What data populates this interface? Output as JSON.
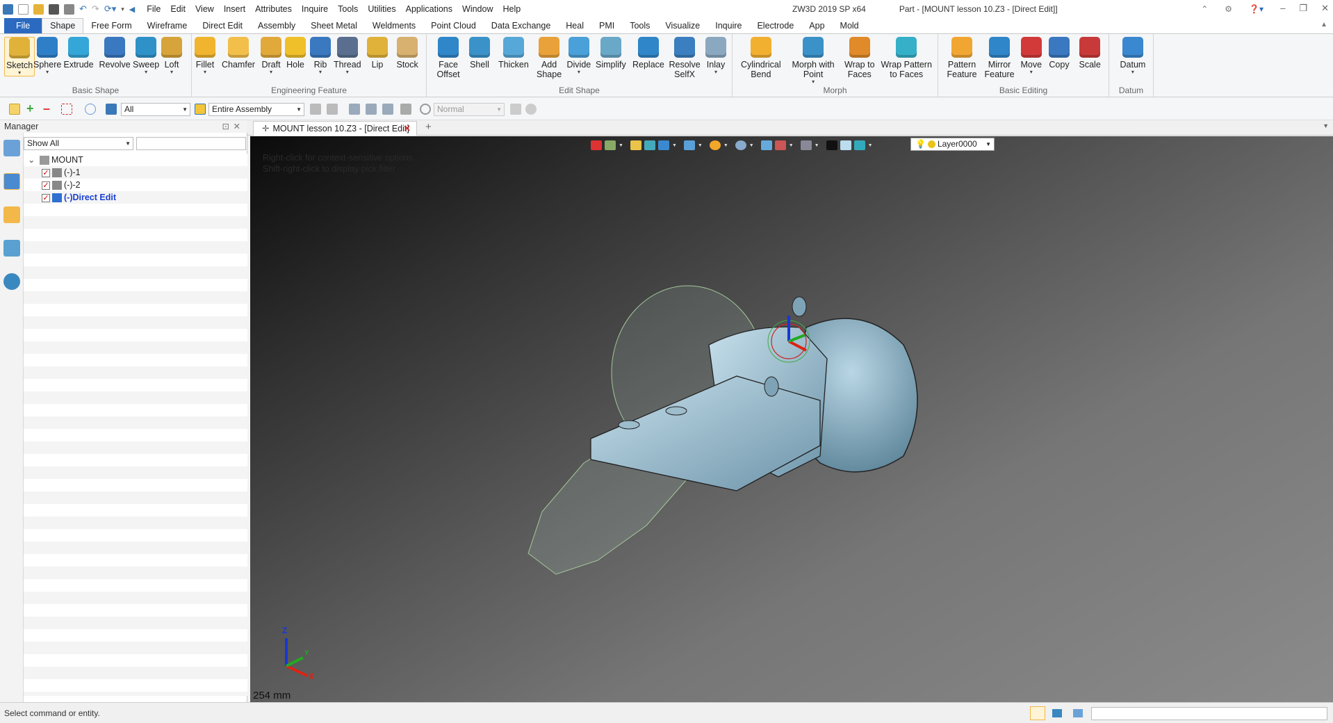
{
  "app": {
    "product": "ZW3D 2019 SP x64",
    "document_title": "Part - [MOUNT lesson 10.Z3 - [Direct Edit]]"
  },
  "menu": [
    "File",
    "Edit",
    "View",
    "Insert",
    "Attributes",
    "Inquire",
    "Tools",
    "Utilities",
    "Applications",
    "Window",
    "Help"
  ],
  "ribbon_tabs": [
    "File",
    "Shape",
    "Free Form",
    "Wireframe",
    "Direct Edit",
    "Assembly",
    "Sheet Metal",
    "Weldments",
    "Point Cloud",
    "Data Exchange",
    "Heal",
    "PMI",
    "Tools",
    "Visualize",
    "Inquire",
    "Electrode",
    "App",
    "Mold"
  ],
  "active_tab": "Shape",
  "ribbon_groups": [
    {
      "title": "Basic Shape",
      "buttons": [
        {
          "label": "Sketch",
          "icon": "sketch-icon"
        },
        {
          "label": "Sphere",
          "icon": "sphere-icon"
        },
        {
          "label": "Extrude",
          "icon": "extrude-icon"
        },
        {
          "label": "Revolve",
          "icon": "revolve-icon"
        },
        {
          "label": "Sweep",
          "icon": "sweep-icon"
        },
        {
          "label": "Loft",
          "icon": "loft-icon"
        }
      ]
    },
    {
      "title": "Engineering Feature",
      "buttons": [
        {
          "label": "Fillet",
          "icon": "fillet-icon"
        },
        {
          "label": "Chamfer",
          "icon": "chamfer-icon"
        },
        {
          "label": "Draft",
          "icon": "draft-icon"
        },
        {
          "label": "Hole",
          "icon": "hole-icon"
        },
        {
          "label": "Rib",
          "icon": "rib-icon"
        },
        {
          "label": "Thread",
          "icon": "thread-icon"
        },
        {
          "label": "Lip",
          "icon": "lip-icon"
        },
        {
          "label": "Stock",
          "icon": "stock-icon"
        }
      ]
    },
    {
      "title": "Edit Shape",
      "buttons": [
        {
          "label": "Face\nOffset",
          "icon": "face-offset-icon"
        },
        {
          "label": "Shell",
          "icon": "shell-icon"
        },
        {
          "label": "Thicken",
          "icon": "thicken-icon"
        },
        {
          "label": "Add\nShape",
          "icon": "add-shape-icon"
        },
        {
          "label": "Divide",
          "icon": "divide-icon"
        },
        {
          "label": "Simplify",
          "icon": "simplify-icon"
        },
        {
          "label": "Replace",
          "icon": "replace-icon"
        },
        {
          "label": "Resolve\nSelfX",
          "icon": "resolve-selfx-icon"
        },
        {
          "label": "Inlay",
          "icon": "inlay-icon"
        }
      ]
    },
    {
      "title": "Morph",
      "buttons": [
        {
          "label": "Cylindrical\nBend",
          "icon": "cylindrical-bend-icon"
        },
        {
          "label": "Morph with\nPoint",
          "icon": "morph-point-icon"
        },
        {
          "label": "Wrap to\nFaces",
          "icon": "wrap-faces-icon"
        },
        {
          "label": "Wrap Pattern\nto Faces",
          "icon": "wrap-pattern-icon"
        }
      ]
    },
    {
      "title": "Basic Editing",
      "buttons": [
        {
          "label": "Pattern\nFeature",
          "icon": "pattern-feature-icon"
        },
        {
          "label": "Mirror\nFeature",
          "icon": "mirror-feature-icon"
        },
        {
          "label": "Move",
          "icon": "move-icon"
        },
        {
          "label": "Copy",
          "icon": "copy-icon"
        },
        {
          "label": "Scale",
          "icon": "scale-icon"
        }
      ]
    },
    {
      "title": "Datum",
      "buttons": [
        {
          "label": "Datum",
          "icon": "datum-icon"
        }
      ]
    }
  ],
  "toolbar": {
    "filter_value": "All",
    "assembly_value": "Entire Assembly",
    "mode_value": "Normal"
  },
  "manager": {
    "title": "Manager",
    "show_filter": "Show All",
    "search_value": "",
    "tree": [
      {
        "label": "MOUNT",
        "level": 0,
        "icon": "assembly-icon"
      },
      {
        "label": "(-)-1",
        "level": 1,
        "icon": "part-icon"
      },
      {
        "label": "(-)-2",
        "level": 1,
        "icon": "part-icon"
      },
      {
        "label": "(-)Direct Edit",
        "level": 1,
        "icon": "part-active-icon",
        "active": true
      }
    ]
  },
  "document_tab": {
    "label": "MOUNT lesson 10.Z3 - [Direct Edit]"
  },
  "viewport": {
    "hint_1": "Right-click for context-sensitive options",
    "hint_2": "Shift-right-click to display pick filter",
    "layer": "Layer0000",
    "scale": "254 mm",
    "triad_x": "X",
    "triad_y": "Y",
    "triad_z": "Z"
  },
  "status": {
    "message": "Select command or entity."
  },
  "colors": {
    "file_tab": "#2b6ac0",
    "model": "#a8c8d8",
    "accent_gold": "#f2b84a"
  }
}
